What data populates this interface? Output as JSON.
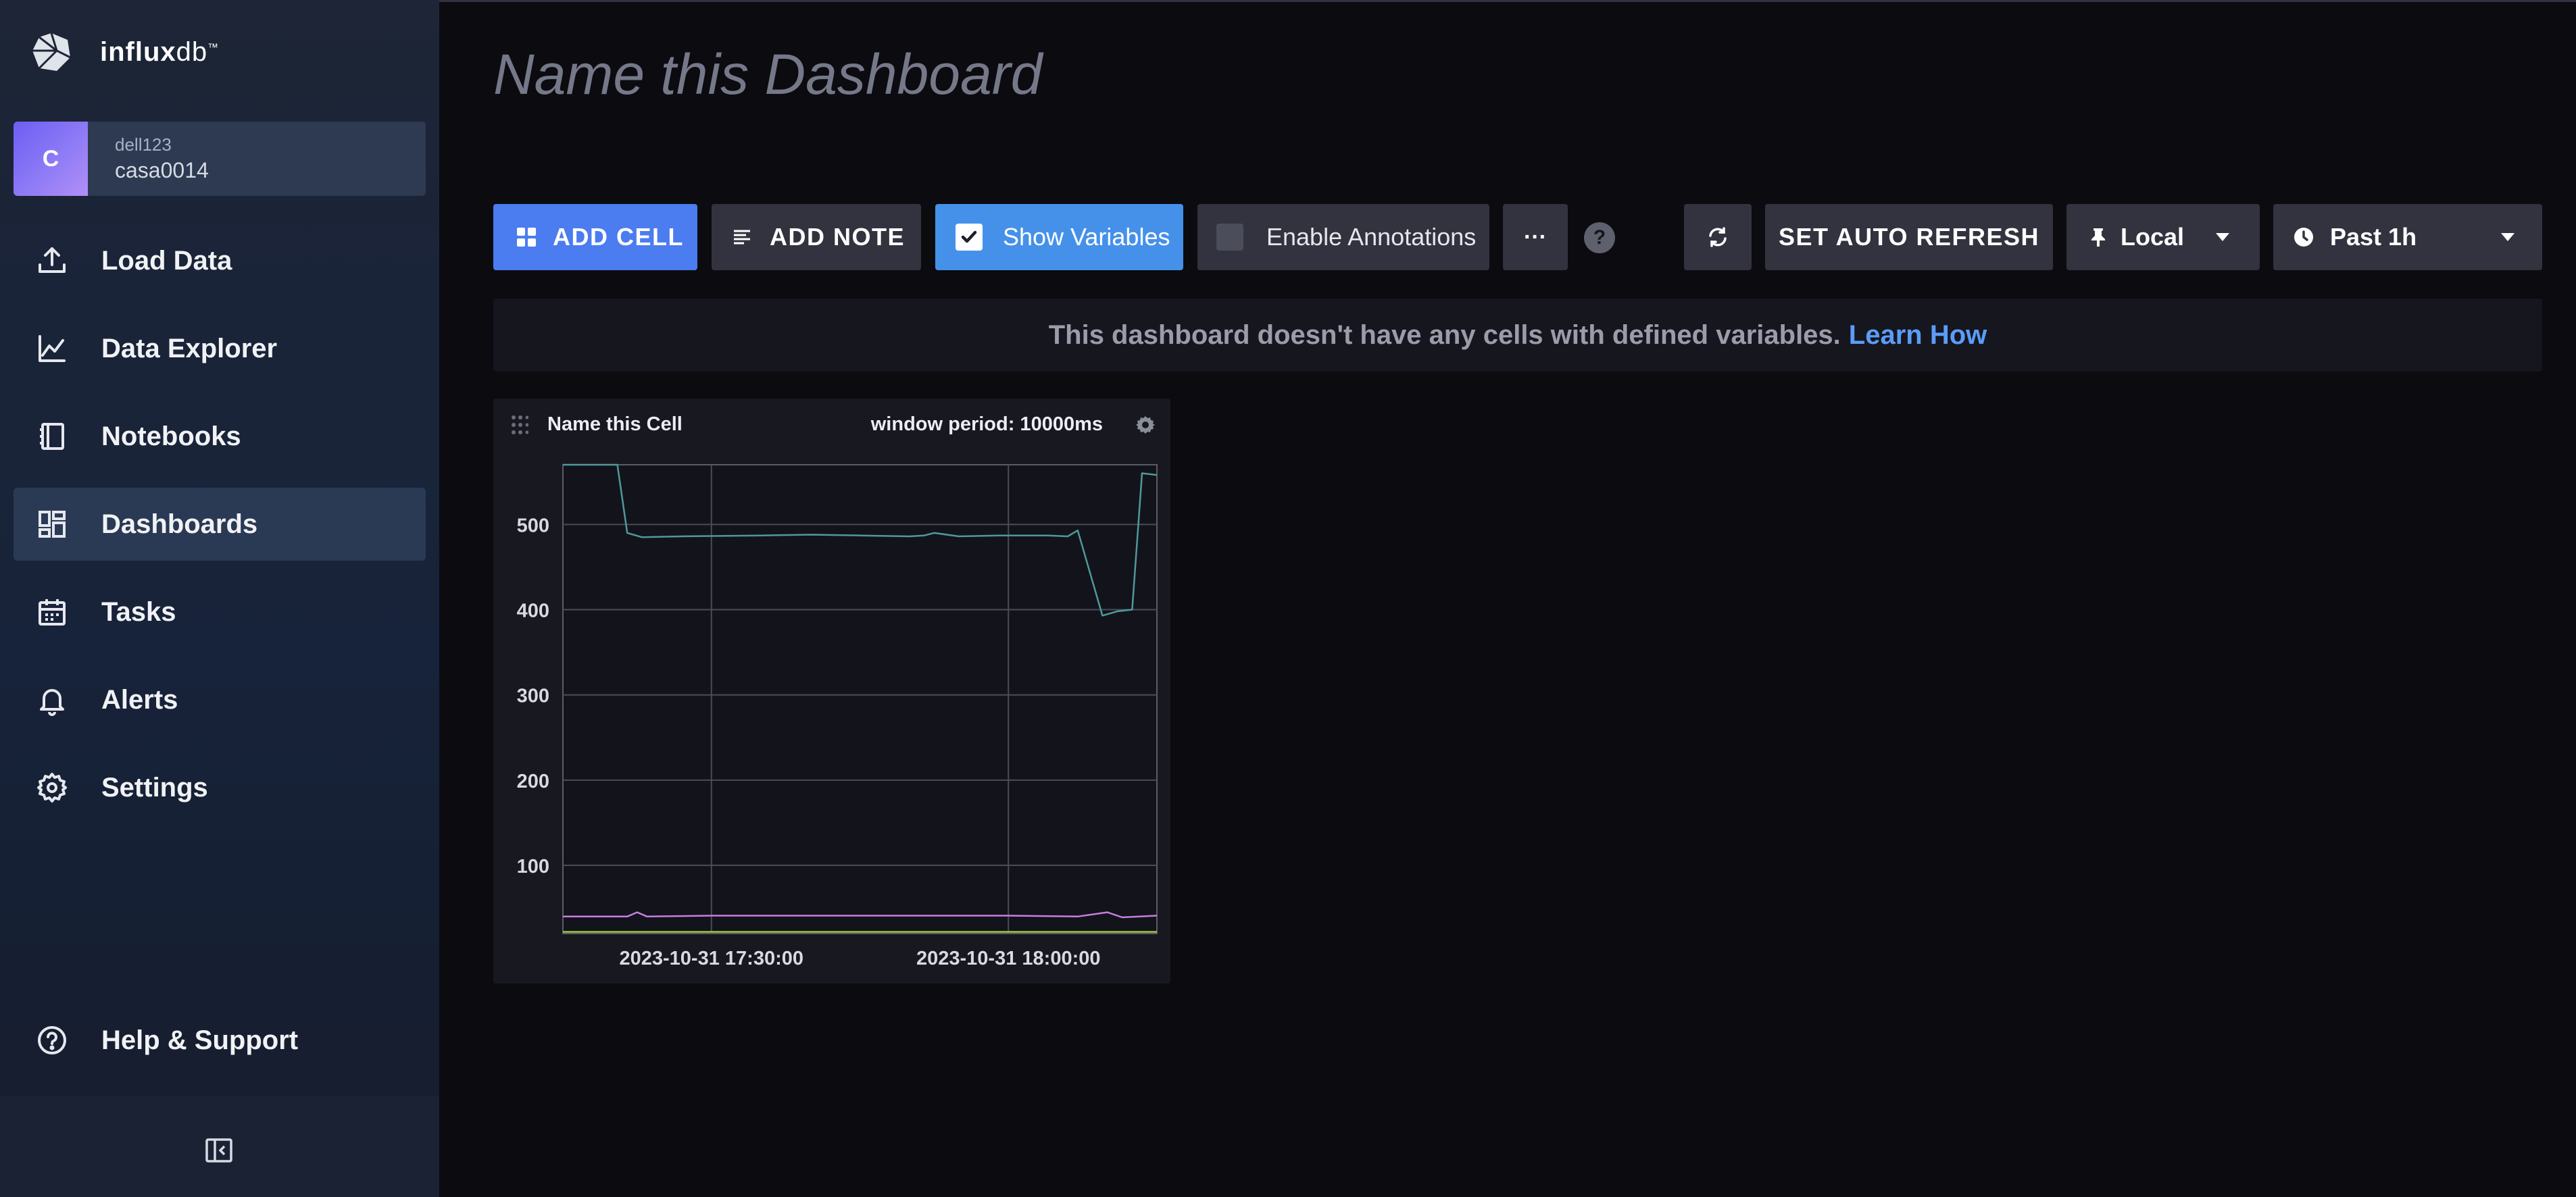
{
  "brand": {
    "name_bold": "influx",
    "name_light": "db",
    "tm": "™"
  },
  "org": {
    "initial": "C",
    "user": "dell123",
    "name": "casa0014"
  },
  "nav": [
    {
      "label": "Load Data",
      "icon": "upload-icon"
    },
    {
      "label": "Data Explorer",
      "icon": "graph-icon"
    },
    {
      "label": "Notebooks",
      "icon": "notebook-icon"
    },
    {
      "label": "Dashboards",
      "icon": "dashboard-icon",
      "active": true
    },
    {
      "label": "Tasks",
      "icon": "calendar-icon"
    },
    {
      "label": "Alerts",
      "icon": "bell-icon"
    },
    {
      "label": "Settings",
      "icon": "gear-icon"
    }
  ],
  "help": {
    "label": "Help & Support"
  },
  "dashboard": {
    "title": "Name this Dashboard"
  },
  "toolbar": {
    "add_cell": "ADD CELL",
    "add_note": "ADD NOTE",
    "show_variables": "Show Variables",
    "show_variables_checked": true,
    "enable_annotations": "Enable Annotations",
    "enable_annotations_checked": false,
    "more": "···",
    "help": "?",
    "auto_refresh": "SET AUTO REFRESH",
    "timezone": "Local",
    "time_range": "Past 1h"
  },
  "notice": {
    "text": "This dashboard doesn't have any cells with defined variables.",
    "link": "Learn How"
  },
  "cell": {
    "title": "Name this Cell",
    "meta": "window period: 10000ms"
  },
  "colors": {
    "accent": "#4b7cf0",
    "series_teal": "#4e9a9a",
    "series_violet": "#c77ee0",
    "series_green": "#9ccc3c"
  },
  "chart_data": {
    "type": "line",
    "title": "",
    "xlabel": "",
    "ylabel": "",
    "ylim": [
      20,
      570
    ],
    "yticks": [
      100,
      200,
      300,
      400,
      500
    ],
    "xlim": [
      "2023-10-31 17:15:00",
      "2023-10-31 18:15:00"
    ],
    "xticks": [
      "2023-10-31 17:30:00",
      "2023-10-31 18:00:00"
    ],
    "grid": true,
    "series": [
      {
        "color": "#4e9a9a",
        "x": [
          "2023-10-31 17:15:00",
          "2023-10-31 17:20:30",
          "2023-10-31 17:21:30",
          "2023-10-31 17:23:00",
          "2023-10-31 17:27:00",
          "2023-10-31 17:35:00",
          "2023-10-31 17:40:00",
          "2023-10-31 17:45:00",
          "2023-10-31 17:50:00",
          "2023-10-31 17:51:30",
          "2023-10-31 17:52:30",
          "2023-10-31 17:55:00",
          "2023-10-31 17:59:00",
          "2023-10-31 18:04:00",
          "2023-10-31 18:06:00",
          "2023-10-31 18:07:00",
          "2023-10-31 18:09:30",
          "2023-10-31 18:11:00",
          "2023-10-31 18:12:30",
          "2023-10-31 18:13:30",
          "2023-10-31 18:15:00"
        ],
        "y": [
          570,
          570,
          490,
          485,
          486,
          487,
          488,
          487,
          486,
          487,
          490,
          486,
          487,
          487,
          486,
          493,
          393,
          398,
          400,
          560,
          558
        ]
      },
      {
        "color": "#c77ee0",
        "x": [
          "2023-10-31 17:15:00",
          "2023-10-31 17:21:30",
          "2023-10-31 17:22:30",
          "2023-10-31 17:23:30",
          "2023-10-31 17:30:00",
          "2023-10-31 18:00:00",
          "2023-10-31 18:07:00",
          "2023-10-31 18:10:00",
          "2023-10-31 18:11:30",
          "2023-10-31 18:15:00"
        ],
        "y": [
          40,
          40,
          45,
          40,
          41,
          41,
          40,
          45,
          39,
          41
        ]
      },
      {
        "color": "#9ccc3c",
        "x": [
          "2023-10-31 17:15:00",
          "2023-10-31 18:15:00"
        ],
        "y": [
          22,
          22
        ]
      }
    ]
  }
}
